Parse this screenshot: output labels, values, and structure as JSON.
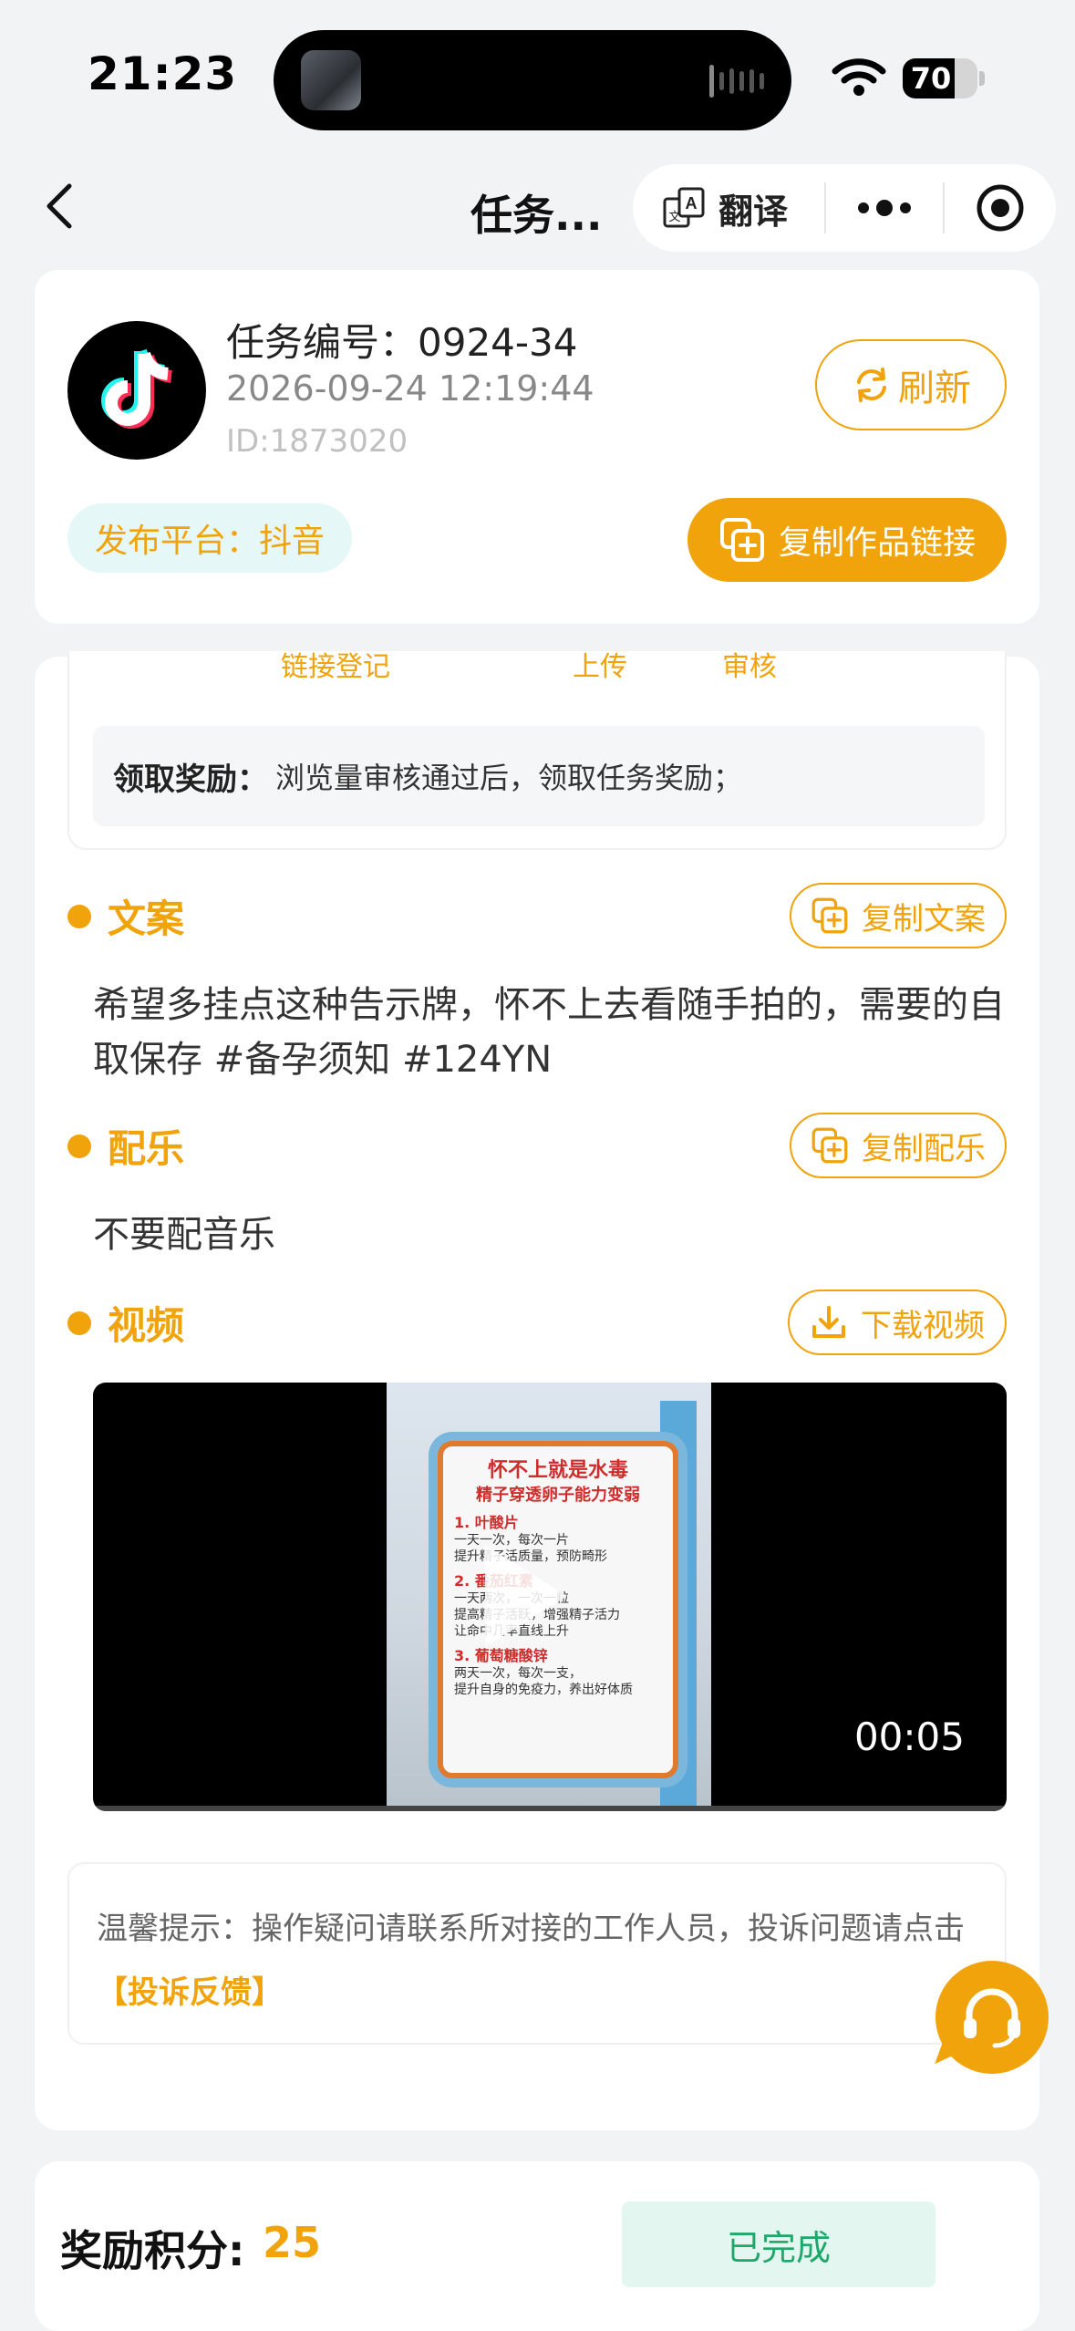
{
  "status_bar": {
    "time": "21:23",
    "battery": "70",
    "battery_level": 0.7
  },
  "nav": {
    "title": "任务...",
    "translate_label": "翻译"
  },
  "task": {
    "number": "任务编号：0924-34",
    "datetime": "2026-09-24 12:19:44",
    "id": "ID:1873020",
    "refresh_label": "刷新",
    "platform": "发布平台：抖音",
    "copy_link_label": "复制作品链接"
  },
  "flow": {
    "steps": [
      "链接登记",
      "上传",
      "审核"
    ],
    "reward_label": "领取奖励：",
    "reward_text": "浏览量审核通过后，领取任务奖励；"
  },
  "copywriting": {
    "title": "文案",
    "copy_label": "复制文案",
    "text": "希望多挂点这种告示牌，怀不上去看随手拍的，需要的自取保存 #备孕须知 #124YN"
  },
  "music": {
    "title": "配乐",
    "copy_label": "复制配乐",
    "text": "不要配音乐"
  },
  "video": {
    "title": "视频",
    "download_label": "下载视频",
    "duration": "00:05",
    "sign": {
      "title1": "怀不上就是水毒",
      "title2": "精子穿透卵子能力变弱",
      "h1": "1. 叶酸片",
      "l1a": "一天一次，每次一片",
      "l1b": "提升精子活质量，预防畸形",
      "h2": "2. 番茄红素",
      "l2a": "一天两次，一次一粒",
      "l2b": "提高精子活跃，增强精子活力",
      "l2c": "让命中几率直线上升",
      "h3": "3. 葡萄糖酸锌",
      "l3a": "两天一次，每次一支，",
      "l3b": "提升自身的免疫力，养出好体质"
    }
  },
  "tip": {
    "prefix": "温馨提示：操作疑问请联系所对接的工作人员，投诉问题请点击",
    "link": "【投诉反馈】"
  },
  "footer": {
    "reward_label": "奖励积分:",
    "reward_value": "25",
    "status_label": "已完成"
  },
  "colors": {
    "accent": "#f0a30a",
    "done_bg": "#e3f6ef",
    "done_text": "#1fa86b"
  }
}
